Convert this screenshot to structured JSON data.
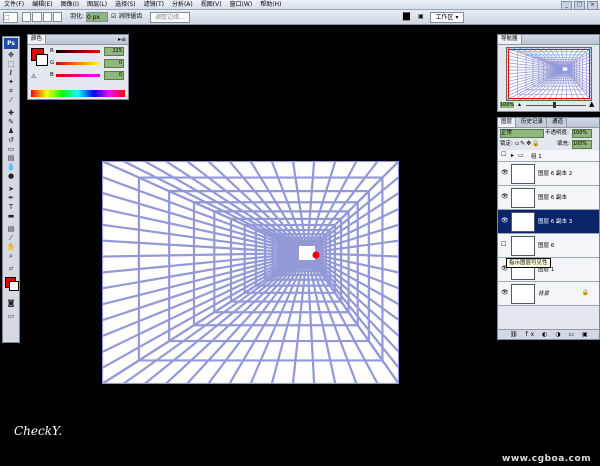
{
  "menu": [
    "文件(F)",
    "编辑(E)",
    "图像(I)",
    "图层(L)",
    "选择(S)",
    "滤镜(T)",
    "分析(A)",
    "视图(V)",
    "窗口(W)",
    "帮助(H)"
  ],
  "options": {
    "feather_label": "羽化:",
    "feather_value": "0 px",
    "antialias_label": "消除锯齿",
    "refine_label": "调整边缘...",
    "workspace_label": "工作区 ▾"
  },
  "color_panel": {
    "tab": "颜色",
    "channels": [
      {
        "label": "R",
        "value": "225"
      },
      {
        "label": "G",
        "value": "0"
      },
      {
        "label": "B",
        "value": "0"
      }
    ],
    "fg_color": "#e10000"
  },
  "nav_panel": {
    "tab": "导航器",
    "zoom": "100%"
  },
  "layers_panel": {
    "tabs": [
      "图层",
      "历史记录",
      "通道"
    ],
    "blend_mode": "正常",
    "opacity_label": "不透明度:",
    "opacity_value": "100%",
    "lock_label": "锁定:",
    "fill_label": "填充:",
    "fill_value": "100%",
    "group_name": "组 1",
    "layers": [
      {
        "name": "图层 6 副本 2",
        "visible": true,
        "selected": false
      },
      {
        "name": "图层 6 副本",
        "visible": true,
        "selected": false
      },
      {
        "name": "图层 6 副本 3",
        "visible": true,
        "selected": true
      },
      {
        "name": "图层 6",
        "visible": false,
        "selected": false
      },
      {
        "name": "图层 1",
        "visible": true,
        "selected": false
      },
      {
        "name": "背景",
        "visible": true,
        "selected": false
      }
    ]
  },
  "tooltip": "指示图层可见性",
  "signature": "CheckY.",
  "watermark": "www.cgboa.com",
  "grid_color": "#8088d0"
}
